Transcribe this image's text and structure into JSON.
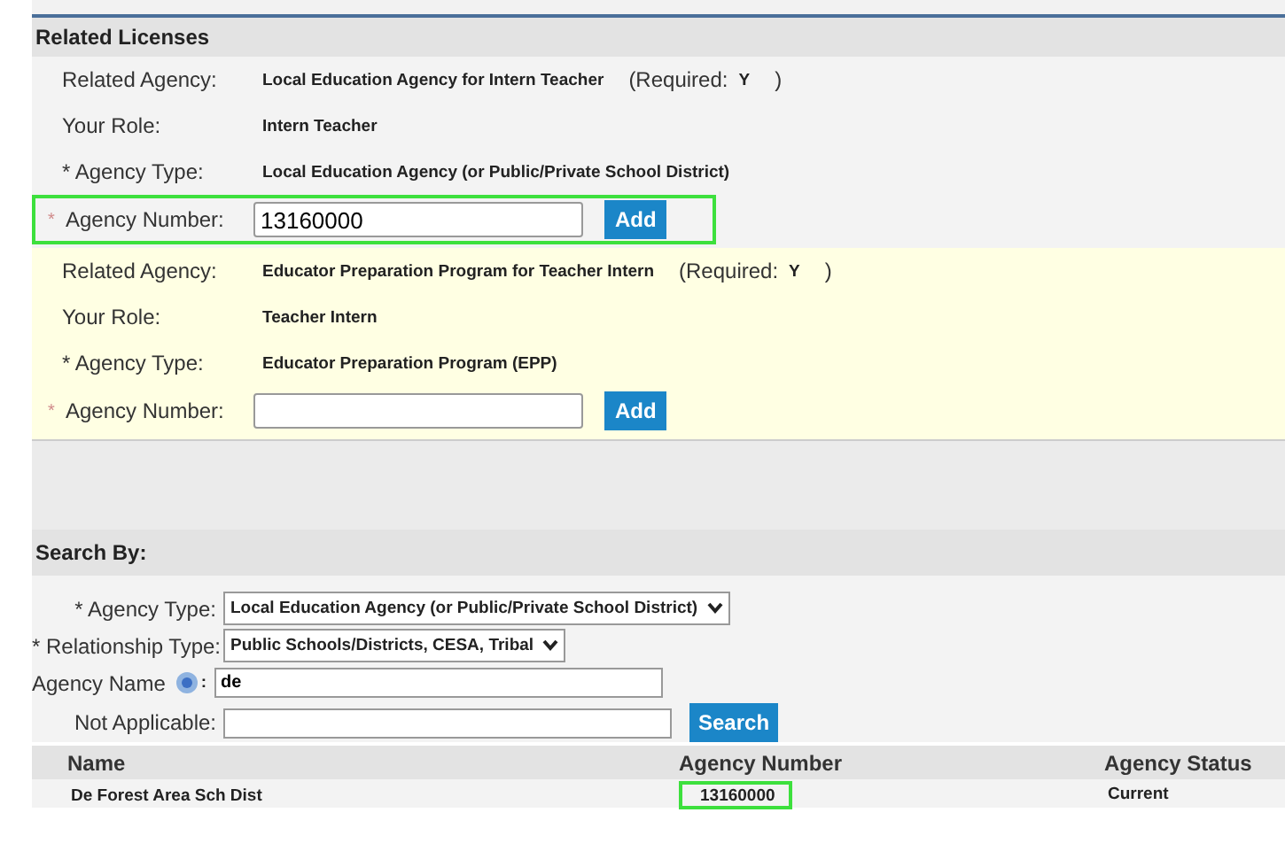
{
  "related_licenses": {
    "title": "Related Licenses",
    "groups": [
      {
        "color": "#f3f3f3",
        "required_mark": "*",
        "related_agency_label": "Related Agency:",
        "related_agency": "Local Education Agency for Intern Teacher",
        "required_label": "(Required:",
        "required_value": "Y",
        "required_close": ")",
        "role_label": "Your Role:",
        "role": "Intern Teacher",
        "type_label": "* Agency Type:",
        "type": "Local Education Agency (or Public/Private School District)",
        "number_label": "Agency Number:",
        "number_value": "13160000",
        "add_button": "Add",
        "highlighted": true
      },
      {
        "color": "#ffffe3",
        "required_mark": "*",
        "related_agency_label": "Related Agency:",
        "related_agency": "Educator Preparation Program for Teacher Intern",
        "required_label": "(Required:",
        "required_value": "Y",
        "required_close": ")",
        "role_label": "Your Role:",
        "role": "Teacher Intern",
        "type_label": "* Agency Type:",
        "type": "Educator Preparation Program (EPP)",
        "number_label": "Agency Number:",
        "add_button": "Add",
        "highlighted": false
      }
    ]
  },
  "search": {
    "title": "Search By:",
    "agency_type_label": "* Agency Type:",
    "agency_type": "Local Education Agency (or Public/Private School District)",
    "relationship_label": "* Relationship Type:",
    "relationship": "Public Schools/Districts, CESA, Tribal",
    "name_label": "Agency Name",
    "name_colon": ":",
    "name_value": "de",
    "not_applicable_label": "Not Applicable:",
    "search_button": "Search"
  },
  "results": {
    "columns": [
      "Name",
      "Agency Number",
      "Agency Status"
    ],
    "rows": [
      {
        "name": "De Forest Area Sch Dist",
        "number": "13160000",
        "status": "Current",
        "number_highlighted": true
      }
    ]
  }
}
